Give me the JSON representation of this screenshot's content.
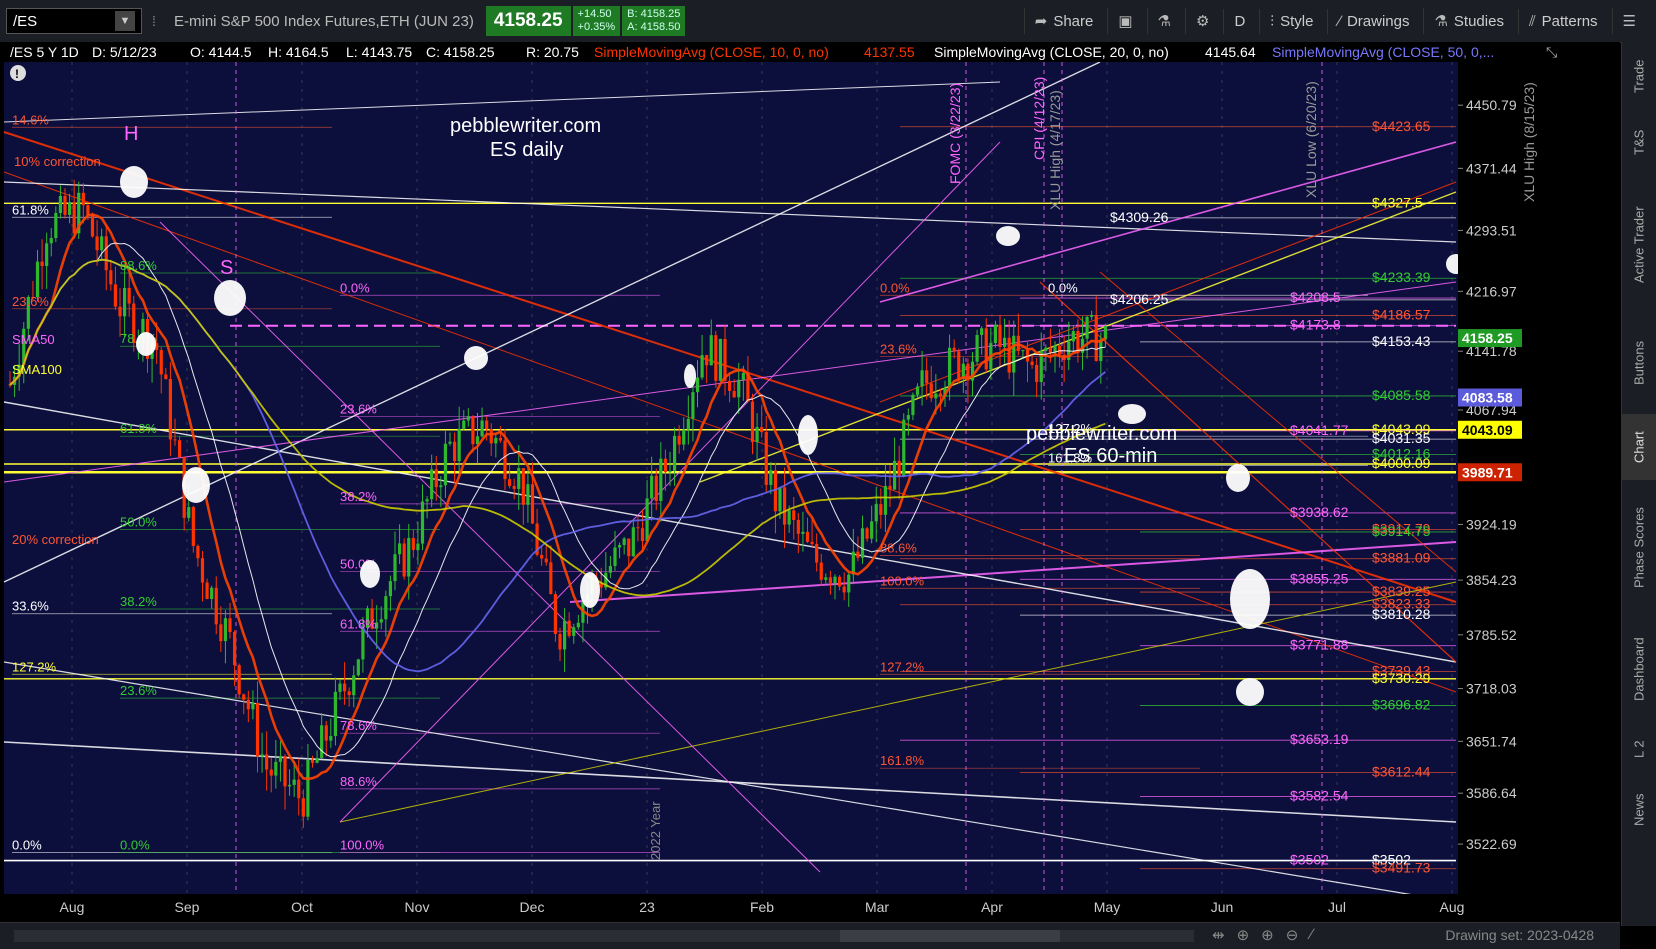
{
  "toolbar": {
    "symbol": "/ES",
    "description": "E-mini S&P 500 Index Futures,ETH (JUN 23)",
    "last": "4158.25",
    "change": "+14.50",
    "change_pct": "+0.35%",
    "bid": "B: 4158.25",
    "ask": "A: 4158.50",
    "share": "Share",
    "aggregation": "D",
    "style": "Style",
    "drawings": "Drawings",
    "studies": "Studies",
    "patterns": "Patterns"
  },
  "header": {
    "symbol": "/ES 5 Y 1D",
    "date": "D: 5/12/23",
    "open": "O: 4144.5",
    "high": "H: 4164.5",
    "low": "L: 4143.75",
    "close": "C: 4158.25",
    "range": "R: 20.75",
    "sma10_label": "SimpleMovingAvg (CLOSE, 10, 0, no)",
    "sma10_value": "4137.55",
    "sma20_label": "SimpleMovingAvg (CLOSE, 20, 0, no)",
    "sma20_value": "4145.64",
    "sma50_label": "SimpleMovingAvg (CLOSE, 50, 0,..."
  },
  "annotations": {
    "site1": "pebblewriter.com",
    "site1b": "ES daily",
    "site2": "pebblewriter.com",
    "site2b": "ES 60-min",
    "H": "H",
    "S": "S",
    "fomc": "FOMC (3/22/23)",
    "cpi": "CPI (4/12/23)",
    "xlu_high": "XLU High (4/17/23)",
    "xlu_low": "XLU Low (6/20/23)",
    "xlu_high2": "XLU High (8/15/23)",
    "year": "2022 Year",
    "correction10": "10% correction",
    "correction20": "20% correction",
    "sma50": "SMA50",
    "sma100": "SMA100"
  },
  "sidebar": {
    "tabs": [
      "Trade",
      "T&S",
      "Active Trader",
      "Buttons",
      "Chart",
      "Phase Scores",
      "Dashboard",
      "L 2",
      "News"
    ]
  },
  "bottom": {
    "drawing_set": "Drawing set: 2023-0428"
  },
  "colors": {
    "background": "#000000",
    "plot_bg": "#0c0f3c",
    "up": "#2eb82e",
    "down": "#ff3300",
    "fib_magenta": "#ff66ff",
    "fib_yellow": "#ffff33",
    "fib_green": "#33cc33",
    "last_tag": "#1f9a24",
    "sma50_tag": "#5b5bdb",
    "sma100_tag": "#ffff00",
    "red_tag": "#cc2200"
  },
  "chart_data": {
    "type": "candlestick",
    "title": "/ES 5 Y 1D",
    "ylim": [
      3460,
      4505
    ],
    "y_ticks": [
      "4450.79",
      "4371.44",
      "4293.51",
      "4216.97",
      "4141.78",
      "4067.94",
      "3924.19",
      "3854.23",
      "3785.52",
      "3718.03",
      "3651.74",
      "3586.64",
      "3522.69"
    ],
    "x_ticks": [
      "Aug",
      "Sep",
      "Oct",
      "Nov",
      "Dec",
      "23",
      "Feb",
      "Mar",
      "Apr",
      "May",
      "Jun",
      "Jul",
      "Aug"
    ],
    "price_tags": [
      {
        "label": "4158.25",
        "value": 4158.25,
        "color": "#1f9a24"
      },
      {
        "label": "4083.58",
        "value": 4083.58,
        "color": "#5b5bdb"
      },
      {
        "label": "4043.09",
        "value": 4043.09,
        "color": "#ffff00"
      },
      {
        "label": "3989.71",
        "value": 3989.71,
        "color": "#cc2200"
      }
    ],
    "level_labels": [
      {
        "text": "$4423.65",
        "value": 4423.65,
        "color": "#ff5533"
      },
      {
        "text": "$4327.5",
        "value": 4327.5,
        "color": "#ffff33"
      },
      {
        "text": "$4309.26",
        "value": 4309.26,
        "color": "#ffffff"
      },
      {
        "text": "$4233.39",
        "value": 4233.39,
        "color": "#33cc33"
      },
      {
        "text": "$4208.5",
        "value": 4208.5,
        "color": "#ff66ff"
      },
      {
        "text": "$4206.25",
        "value": 4206.25,
        "color": "#ffffff"
      },
      {
        "text": "$4186.57",
        "value": 4186.57,
        "color": "#ff5533"
      },
      {
        "text": "$4173.8",
        "value": 4173.8,
        "color": "#ff66ff"
      },
      {
        "text": "$4153.43",
        "value": 4153.43,
        "color": "#ffffff"
      },
      {
        "text": "$4085.58",
        "value": 4085.58,
        "color": "#33cc33"
      },
      {
        "text": "$4043.09",
        "value": 4043.09,
        "color": "#ffff33"
      },
      {
        "text": "$4041.77",
        "value": 4041.77,
        "color": "#ff66ff"
      },
      {
        "text": "$4031.35",
        "value": 4031.35,
        "color": "#ffffff"
      },
      {
        "text": "$4012.16",
        "value": 4012.16,
        "color": "#33cc33"
      },
      {
        "text": "$4000.09",
        "value": 4000.09,
        "color": "#ffff33"
      },
      {
        "text": "$3938.62",
        "value": 3938.62,
        "color": "#ff66ff"
      },
      {
        "text": "$3917.79",
        "value": 3917.79,
        "color": "#ff5533"
      },
      {
        "text": "$3914.75",
        "value": 3914.75,
        "color": "#33cc33"
      },
      {
        "text": "$3881.09",
        "value": 3881.09,
        "color": "#ff5533"
      },
      {
        "text": "$3855.25",
        "value": 3855.25,
        "color": "#ff66ff"
      },
      {
        "text": "$3839.25",
        "value": 3839.25,
        "color": "#ff5533"
      },
      {
        "text": "$3823.33",
        "value": 3823.33,
        "color": "#ff5533"
      },
      {
        "text": "$3810.28",
        "value": 3810.28,
        "color": "#ffffff"
      },
      {
        "text": "$3771.88",
        "value": 3771.88,
        "color": "#ff66ff"
      },
      {
        "text": "$3739.43",
        "value": 3739.43,
        "color": "#ff5533"
      },
      {
        "text": "$3730.29",
        "value": 3730.29,
        "color": "#ffff33"
      },
      {
        "text": "$3696.82",
        "value": 3696.82,
        "color": "#33cc33"
      },
      {
        "text": "$3653.19",
        "value": 3653.19,
        "color": "#ff66ff"
      },
      {
        "text": "$3612.44",
        "value": 3612.44,
        "color": "#ff5533"
      },
      {
        "text": "$3582.54",
        "value": 3582.54,
        "color": "#ff66ff"
      },
      {
        "text": "$3502",
        "value": 3502,
        "color": "#ffffff"
      },
      {
        "text": "$3502",
        "value": 3502,
        "color": "#ff66ff"
      },
      {
        "text": "$3491.73",
        "value": 3491.73,
        "color": "#ff5533"
      }
    ],
    "fib_labels": [
      {
        "text": "14.6%",
        "value": 4423,
        "color": "#ff5533"
      },
      {
        "text": "61.8%",
        "value": 4310,
        "color": "#ffffff"
      },
      {
        "text": "88.6%",
        "value": 4240,
        "color": "#33cc33"
      },
      {
        "text": "23.6%",
        "value": 4195,
        "color": "#ff5533"
      },
      {
        "text": "0.0%",
        "value": 4212,
        "color": "#ff66ff"
      },
      {
        "text": "78.6%",
        "value": 4148,
        "color": "#33cc33"
      },
      {
        "text": "23.6%",
        "value": 4060,
        "color": "#ff66ff"
      },
      {
        "text": "61.8%",
        "value": 4035,
        "color": "#33cc33"
      },
      {
        "text": "38.2%",
        "value": 3950,
        "color": "#ff66ff"
      },
      {
        "text": "50.0%",
        "value": 3918,
        "color": "#33cc33"
      },
      {
        "text": "50.0%",
        "value": 3865,
        "color": "#ff66ff"
      },
      {
        "text": "38.2%",
        "value": 3818,
        "color": "#33cc33"
      },
      {
        "text": "33.6%",
        "value": 3812,
        "color": "#ffffff"
      },
      {
        "text": "61.8%",
        "value": 3790,
        "color": "#ff66ff"
      },
      {
        "text": "127.2%",
        "value": 3736,
        "color": "#ffff33"
      },
      {
        "text": "23.6%",
        "value": 3706,
        "color": "#33cc33"
      },
      {
        "text": "78.6%",
        "value": 3662,
        "color": "#ff66ff"
      },
      {
        "text": "88.6%",
        "value": 3592,
        "color": "#ff66ff"
      },
      {
        "text": "0.0%",
        "value": 3512,
        "color": "#ffffff"
      },
      {
        "text": "0.0%",
        "value": 3512,
        "color": "#33cc33"
      },
      {
        "text": "100.0%",
        "value": 3512,
        "color": "#ff66ff"
      },
      {
        "text": "0.0%",
        "value": 4212,
        "color": "#ff5533"
      },
      {
        "text": "23.6%",
        "value": 4135,
        "color": "#ff5533"
      },
      {
        "text": "127.2%",
        "value": 3736,
        "color": "#ff5533"
      },
      {
        "text": "161.8%",
        "value": 3618,
        "color": "#ff5533"
      },
      {
        "text": "88.6%",
        "value": 3885,
        "color": "#ff5533"
      },
      {
        "text": "100.0%",
        "value": 3844,
        "color": "#ff5533"
      },
      {
        "text": "0.0%",
        "value": 4212,
        "color": "#ffffff"
      },
      {
        "text": "127.2%",
        "value": 4035,
        "color": "#ffffff"
      },
      {
        "text": "161.8%",
        "value": 3998,
        "color": "#ffffff"
      }
    ],
    "series": [
      {
        "name": "SMA10",
        "color": "#ff4400"
      },
      {
        "name": "SMA20",
        "color": "#ffffff"
      },
      {
        "name": "SMA50",
        "color": "#6666ee"
      },
      {
        "name": "SMA100",
        "color": "#cccc00"
      }
    ]
  }
}
